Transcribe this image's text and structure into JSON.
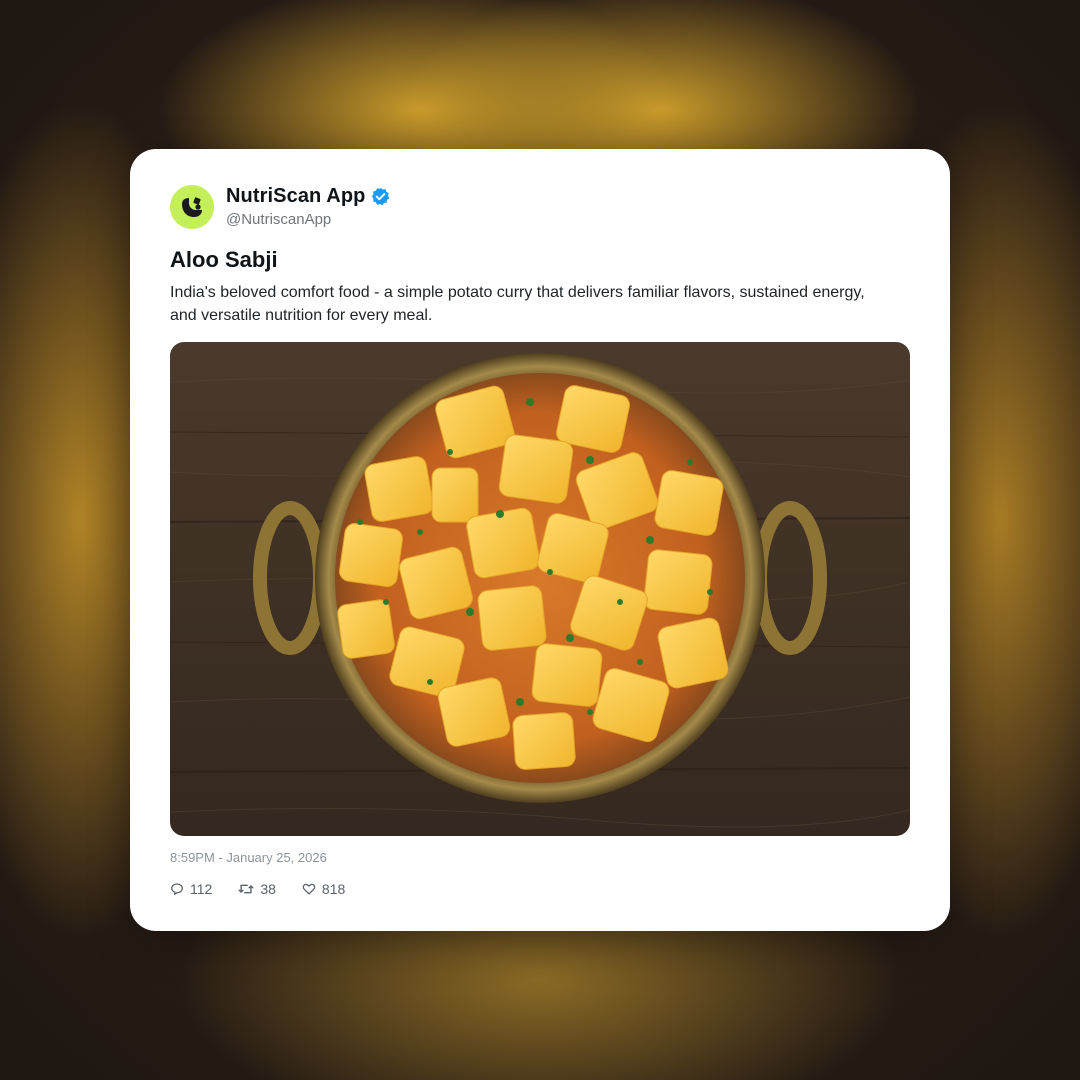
{
  "post": {
    "author_name": "NutriScan App",
    "author_handle": "@NutriscanApp",
    "verified": true,
    "title": "Aloo Sabji",
    "description": "India's beloved comfort food - a simple potato curry that delivers familiar flavors, sustained energy, and versatile nutrition for every meal.",
    "timestamp": "8:59PM - January 25, 2026",
    "image_subject": "aloo-sabji-in-brass-bowl"
  },
  "stats": {
    "replies": "112",
    "retweets": "38",
    "likes": "818"
  },
  "icons": {
    "avatar": "nutriscan-logo-icon",
    "verified": "verified-badge-icon",
    "reply": "comment-icon",
    "retweet": "retweet-icon",
    "like": "heart-icon"
  },
  "colors": {
    "avatar_bg": "#c4ee5a",
    "verified_blue": "#1d9bf0",
    "card_bg": "#ffffff"
  }
}
